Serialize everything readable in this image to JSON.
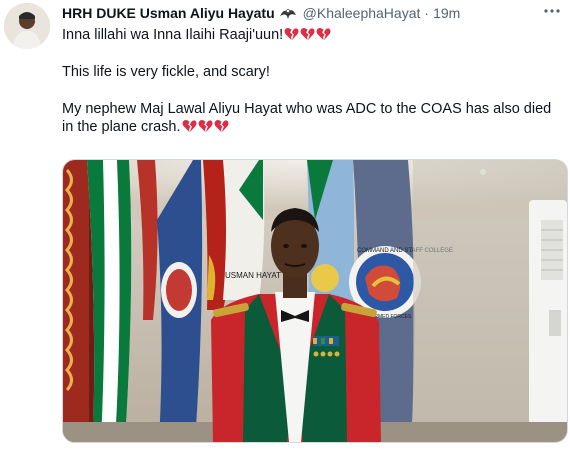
{
  "tweet": {
    "display_name": "HRH DUKE Usman Aliyu Hayatu",
    "handle": "@KhaleephaHayat",
    "separator": "·",
    "time": "19m",
    "lines": [
      "Inna lillahi wa Inna Ilaihi Raaji'uun!",
      "This life is very fickle, and scary!",
      "My nephew Maj Lawal Aliyu Hayat who was ADC to the COAS has also died",
      "in the plane crash."
    ],
    "emoji": {
      "broken_heart_count_line1": 3,
      "broken_heart_count_line4": 3,
      "heart_color": "#dd2e44"
    },
    "photo": {
      "badge_text": "USMAN HAYAT",
      "college_text": "COMMAND AND STAFF COLLEGE",
      "college_motto": "ARMED FORCES"
    }
  },
  "colors": {
    "name": "#0f1419",
    "secondary": "#536471",
    "uniform_red": "#c8262b",
    "flag_green": "#0a7a3c"
  }
}
